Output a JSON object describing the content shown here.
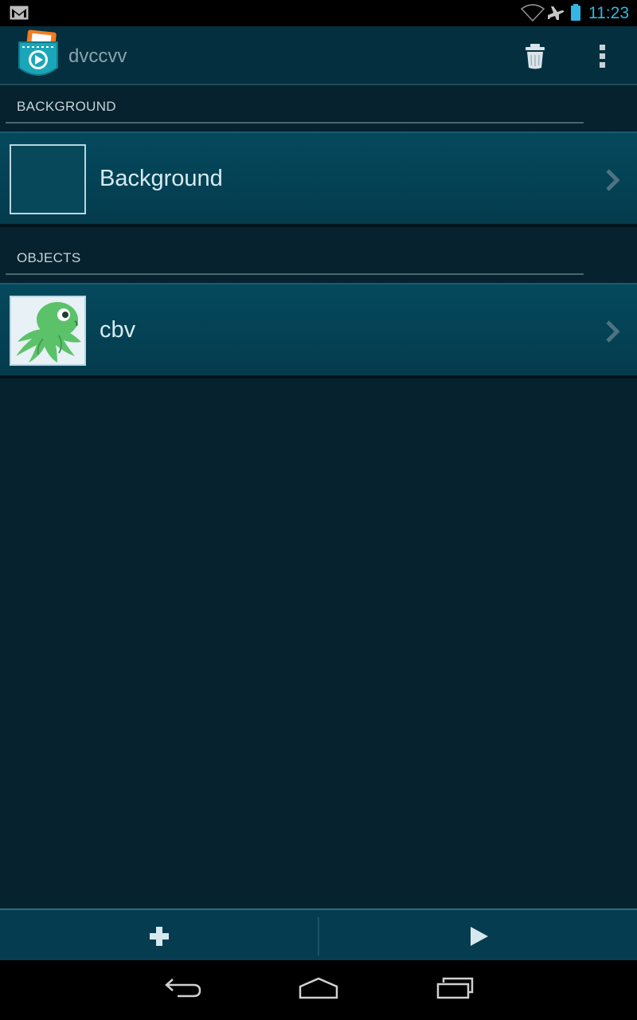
{
  "status_bar": {
    "time": "11:23",
    "icons": [
      "gmail-icon",
      "wifi-icon",
      "airplane-icon",
      "battery-icon"
    ],
    "accent_color": "#33b5e5"
  },
  "action_bar": {
    "title": "dvccvv",
    "icons": [
      "app-logo-icon",
      "trash-icon",
      "overflow-menu-icon"
    ]
  },
  "sections": {
    "background": {
      "header": "BACKGROUND",
      "items": [
        {
          "label": "Background",
          "thumbnail": "empty"
        }
      ]
    },
    "objects": {
      "header": "OBJECTS",
      "items": [
        {
          "label": "cbv",
          "thumbnail": "octopus"
        }
      ]
    }
  },
  "bottom_bar": {
    "icons": [
      "add-icon",
      "play-icon"
    ]
  },
  "nav_bar": {
    "icons": [
      "back-icon",
      "home-icon",
      "recent-apps-icon"
    ]
  }
}
